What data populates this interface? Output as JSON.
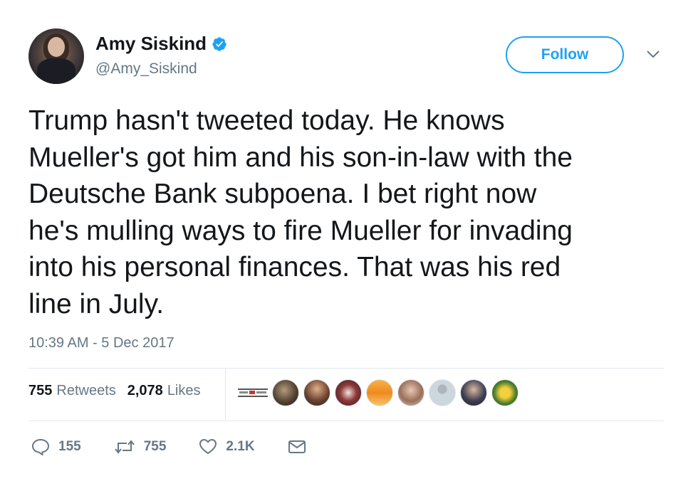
{
  "user": {
    "name": "Amy Siskind",
    "handle": "@Amy_Siskind",
    "verified": true
  },
  "header": {
    "follow_label": "Follow"
  },
  "tweet": {
    "text": "Trump hasn't tweeted today.  He knows\nMueller's got him and his son-in-law with the\nDeutsche Bank subpoena.  I bet right now\nhe's mulling ways to fire Mueller for invading\ninto his personal finances.  That was his red\nline in July.",
    "timestamp": "10:39 AM - 5 Dec 2017"
  },
  "stats": {
    "retweets_count": "755",
    "retweets_label": "Retweets",
    "likes_count": "2,078",
    "likes_label": "Likes"
  },
  "likers": [
    {
      "name": "liker-logo"
    },
    {
      "name": "liker-1"
    },
    {
      "name": "liker-2"
    },
    {
      "name": "liker-3"
    },
    {
      "name": "liker-4"
    },
    {
      "name": "liker-5"
    },
    {
      "name": "liker-6"
    },
    {
      "name": "liker-7"
    },
    {
      "name": "liker-8"
    }
  ],
  "actions": {
    "reply_count": "155",
    "retweet_count": "755",
    "like_count": "2.1K"
  },
  "colors": {
    "accent": "#1da1f2",
    "text": "#14171a",
    "secondary": "#657786",
    "divider": "#e1e8ed"
  },
  "icons": {
    "verified": "verified-badge-icon",
    "caret": "chevron-down-icon",
    "reply": "reply-icon",
    "retweet": "retweet-icon",
    "like": "heart-icon",
    "dm": "envelope-icon"
  }
}
